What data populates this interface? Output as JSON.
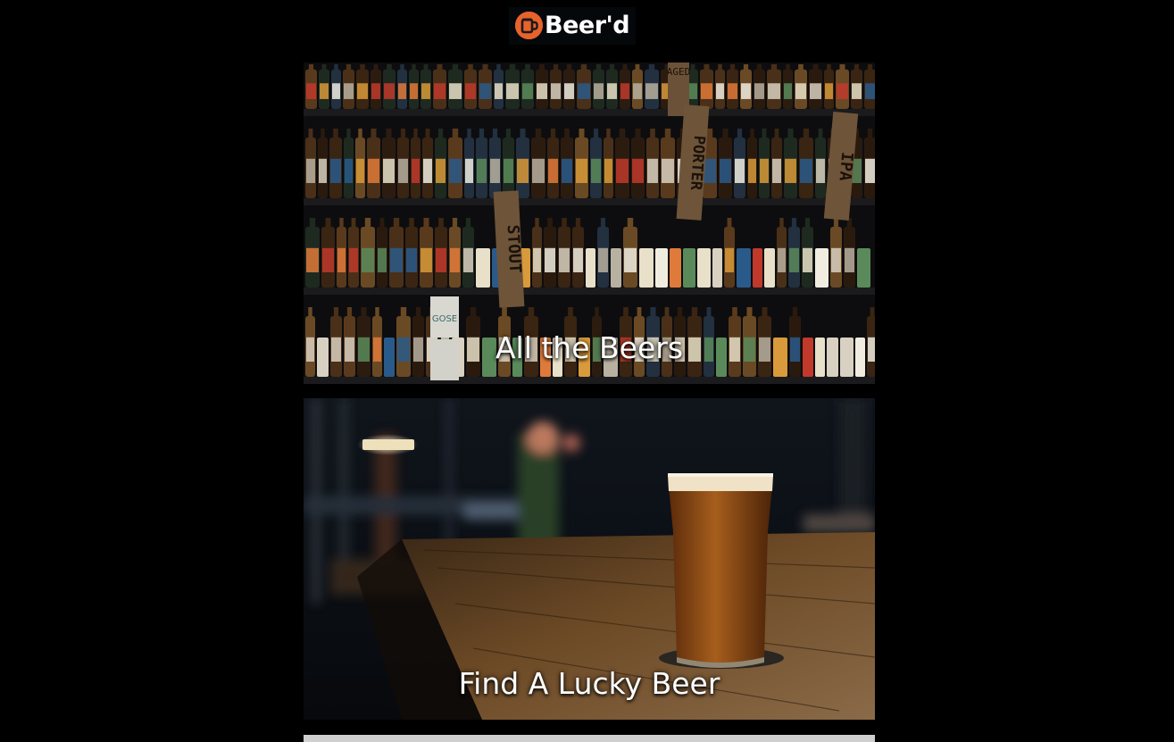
{
  "header": {
    "logo_text": "Beer'd",
    "logo_icon": "beer-mug-icon",
    "brand_color": "#e8622c"
  },
  "cards": [
    {
      "title": "All the Beers",
      "image": "beer-shelves-photo",
      "shelf_signs": [
        "AGED",
        "PORTER",
        "IPA",
        "STOUT",
        "GOSE"
      ]
    },
    {
      "title": "Find A Lucky Beer",
      "image": "pint-on-bar-photo"
    }
  ],
  "colors": {
    "background": "#000000",
    "text": "#ffffff"
  }
}
